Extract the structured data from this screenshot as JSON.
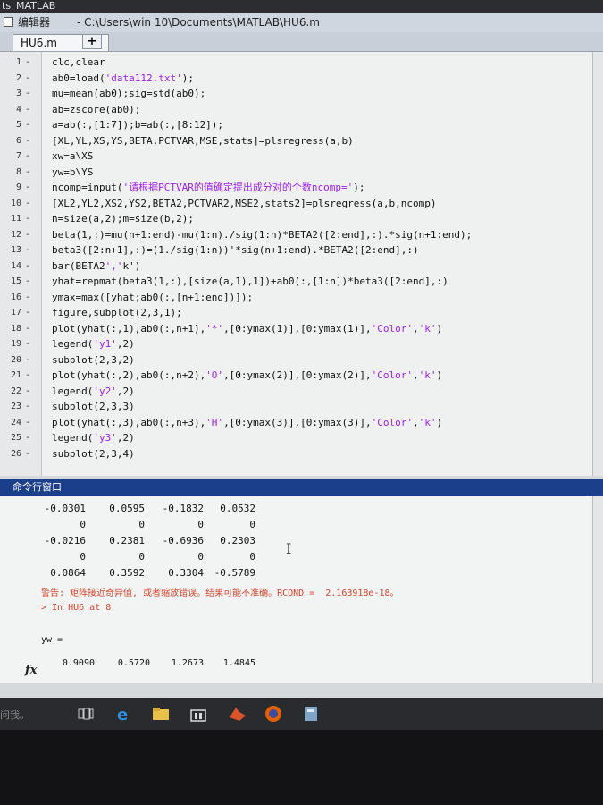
{
  "top_strip": {
    "left": "ts",
    "app_name": "MATLAB"
  },
  "title_bar": {
    "label": "编辑器",
    "path": "- C:\\Users\\win  10\\Documents\\MATLAB\\HU6.m"
  },
  "tab": {
    "name": "HU6.m",
    "close": "×",
    "add": "+"
  },
  "editor_lines": [
    {
      "n": "1",
      "code": "clc,clear"
    },
    {
      "n": "2",
      "code": "ab0=load('data112.txt');"
    },
    {
      "n": "3",
      "code": "mu=mean(ab0);sig=std(ab0);"
    },
    {
      "n": "4",
      "code": "ab=zscore(ab0);"
    },
    {
      "n": "5",
      "code": "a=ab(:,[1:7]);b=ab(:,[8:12]);"
    },
    {
      "n": "6",
      "code": "[XL,YL,XS,YS,BETA,PCTVAR,MSE,stats]=plsregress(a,b)"
    },
    {
      "n": "7",
      "code": "xw=a\\XS"
    },
    {
      "n": "8",
      "code": "yw=b\\YS"
    },
    {
      "n": "9",
      "code": "ncomp=input('请根据PCTVAR的值确定提出成分对的个数ncomp=');"
    },
    {
      "n": "10",
      "code": "[XL2,YL2,XS2,YS2,BETA2,PCTVAR2,MSE2,stats2]=plsregress(a,b,ncomp)"
    },
    {
      "n": "11",
      "code": "n=size(a,2);m=size(b,2);"
    },
    {
      "n": "12",
      "code": "beta(1,:)=mu(n+1:end)-mu(1:n)./sig(1:n)*BETA2([2:end],:).*sig(n+1:end);"
    },
    {
      "n": "13",
      "code": "beta3([2:n+1],:)=(1./sig(1:n))'*sig(n+1:end).*BETA2([2:end],:)"
    },
    {
      "n": "14",
      "code": "bar(BETA2','k')"
    },
    {
      "n": "15",
      "code": "yhat=repmat(beta3(1,:),[size(a,1),1])+ab0(:,[1:n])*beta3([2:end],:)"
    },
    {
      "n": "16",
      "code": "ymax=max([yhat;ab0(:,[n+1:end])]);"
    },
    {
      "n": "17",
      "code": "figure,subplot(2,3,1);"
    },
    {
      "n": "18",
      "code": "plot(yhat(:,1),ab0(:,n+1),'*',[0:ymax(1)],[0:ymax(1)],'Color','k')"
    },
    {
      "n": "19",
      "code": "legend('y1',2)"
    },
    {
      "n": "20",
      "code": "subplot(2,3,2)"
    },
    {
      "n": "21",
      "code": "plot(yhat(:,2),ab0(:,n+2),'O',[0:ymax(2)],[0:ymax(2)],'Color','k')"
    },
    {
      "n": "22",
      "code": "legend('y2',2)"
    },
    {
      "n": "23",
      "code": "subplot(2,3,3)"
    },
    {
      "n": "24",
      "code": "plot(yhat(:,3),ab0(:,n+3),'H',[0:ymax(3)],[0:ymax(3)],'Color','k')"
    },
    {
      "n": "25",
      "code": "legend('y3',2)"
    },
    {
      "n": "26",
      "code": "subplot(2,3,4)"
    }
  ],
  "command_window": {
    "title": "命令行窗口",
    "matrix": [
      [
        "-0.0301",
        "0.0595",
        "-0.1832",
        "0.0532"
      ],
      [
        "0",
        "0",
        "0",
        "0"
      ],
      [
        "-0.0216",
        "0.2381",
        "-0.6936",
        "0.2303"
      ],
      [
        "0",
        "0",
        "0",
        "0"
      ],
      [
        "0.0864",
        "0.3592",
        "0.3304",
        "-0.5789"
      ]
    ],
    "warning": "警告: 矩阵接近奇异值, 或者缩放错误。结果可能不准确。RCOND =  2.163918e-18。",
    "location": "> In HU6 at 8",
    "yw_label": "yw =",
    "last_row": [
      "0.9090",
      "0.5720",
      "1.2673",
      "1.4845"
    ],
    "prompt_symbol": "fx"
  },
  "taskbar": {
    "search_hint": "问我。"
  },
  "colors": {
    "header": "#1c3f8c",
    "warning": "#d9452b",
    "string": "#a020f0"
  }
}
